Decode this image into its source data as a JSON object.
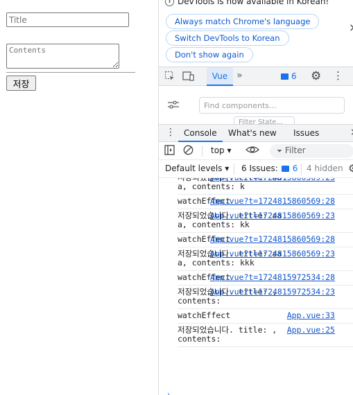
{
  "app": {
    "title_placeholder": "Title",
    "contents_placeholder": "Contents",
    "save_label": "저장"
  },
  "notice": {
    "text": "DevTools is now available in Korean!",
    "buttons": [
      "Always match Chrome's language",
      "Switch DevTools to Korean",
      "Don't show again"
    ],
    "close": "×"
  },
  "main_tabs": {
    "vue": "Vue",
    "more": "»",
    "issue_count": "6"
  },
  "vue_panel": {
    "search_placeholder": "Find components...",
    "filter_placeholder": "Filter State..."
  },
  "drawer": {
    "tabs": [
      "Console",
      "What's new",
      "Issues"
    ],
    "context": "top",
    "filter_placeholder": "Filter",
    "levels": "Default levels",
    "issues_label": "6 Issues:",
    "issues_count": "6",
    "hidden": "4 hidden"
  },
  "console": {
    "entries": [
      {
        "message": "저장되었습니다. title: aaa, contents: k",
        "source": "App.vue?t=1724815860569:23"
      },
      {
        "message": "watchEffect",
        "source": "App.vue?t=1724815860569:28"
      },
      {
        "message": "저장되었습니다. title: aaa, contents: kk",
        "source": "App.vue?t=1724815860569:23"
      },
      {
        "message": "watchEffect",
        "source": "App.vue?t=1724815860569:28"
      },
      {
        "message": "저장되었습니다. title: aaa, contents: kkk",
        "source": "App.vue?t=1724815860569:23"
      },
      {
        "message": "watchEffect",
        "source": "App.vue?t=1724815972534:28"
      },
      {
        "message": "저장되었습니다. title: , contents:",
        "source": "App.vue?t=1724815972534:23"
      },
      {
        "message": "watchEffect",
        "source": "App.vue:33"
      },
      {
        "message": "저장되었습니다. title: , contents:",
        "source": "App.vue:25"
      }
    ]
  }
}
